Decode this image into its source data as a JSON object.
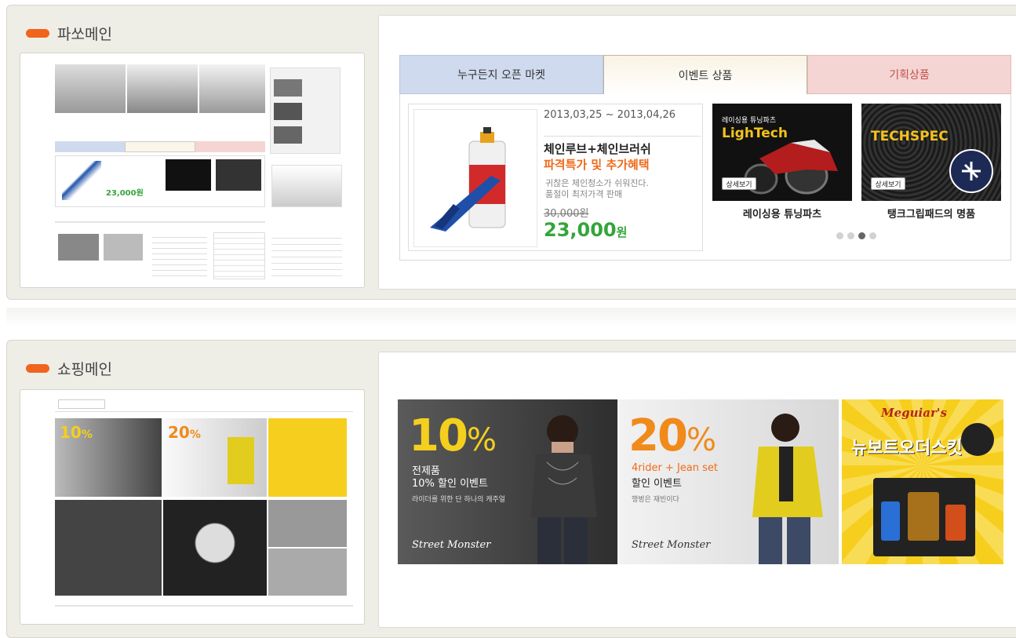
{
  "section1": {
    "title": "파쏘메인",
    "tabs": [
      "누구든지 오픈 마켓",
      "이벤트 상품",
      "기획상품"
    ],
    "event": {
      "date": "2013,03,25 ~ 2013,04,26",
      "title_line1": "체인루브+체인브러쉬",
      "title_line2": "파격특가 및 추가혜택",
      "desc_line1": "귀찮은 체인청소가 쉬워진다.",
      "desc_line2": "품절이 최저가격 판매",
      "old_price": "30,000원",
      "price": "23,000",
      "price_unit": "원"
    },
    "banners": [
      {
        "sub": "레이싱용 튜닝파츠",
        "name": "LighTech",
        "button": "상세보기",
        "caption": "레이싱용 튜닝파츠"
      },
      {
        "sub": "",
        "name": "TECHSPEC",
        "button": "상세보기",
        "caption": "탱크그립패드의 명품"
      }
    ],
    "carousel": {
      "count": 4,
      "active": 2
    }
  },
  "section2": {
    "title": "쇼핑메인",
    "banners": [
      {
        "pct": "10",
        "sign": "%",
        "line1": "전제품",
        "line2": "10% 할인 이벤트",
        "line3": "라이더를 위한 단 하나의 캐주얼"
      },
      {
        "pct": "20",
        "sign": "%",
        "line1": "4rider + Jean set",
        "line2": "할인 이벤트",
        "line3": "행벙은 재빈이다"
      },
      {
        "label1": "뉴보트",
        "label2": "오더스킷"
      }
    ]
  },
  "colors": {
    "accent": "#f0641e",
    "price_green": "#33a53b",
    "tab_blue": "#cfdaee",
    "tab_pink": "#f5d5d3"
  }
}
